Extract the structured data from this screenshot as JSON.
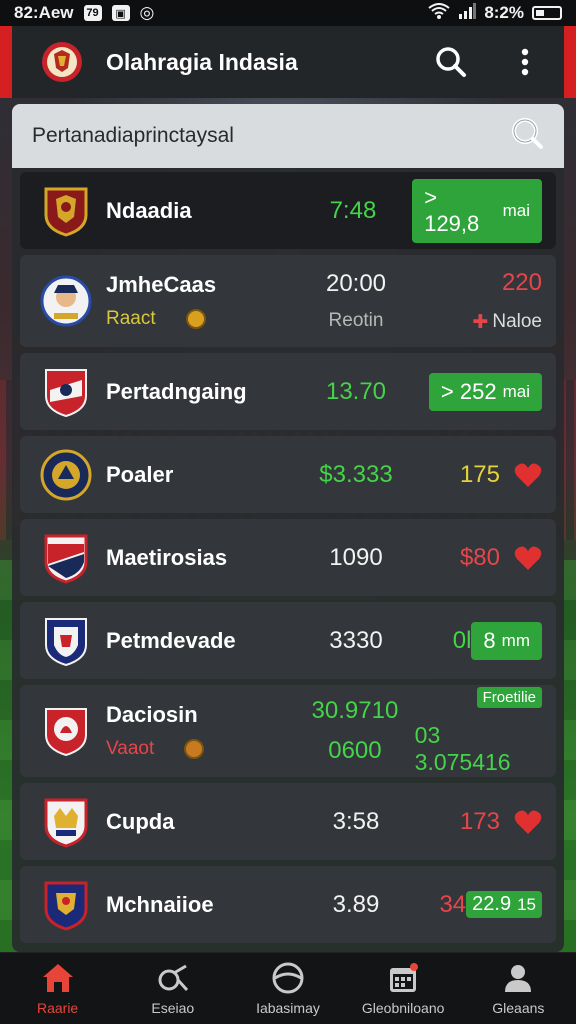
{
  "status_bar": {
    "time": "82:Aew",
    "icon_a": "79",
    "battery_text": "8:2%"
  },
  "app_bar": {
    "title": "Olahragia Indasia",
    "icons": [
      "crest-icon",
      "search-icon",
      "more-vert-icon"
    ]
  },
  "search": {
    "placeholder": "Pertanadiaprinctaysal"
  },
  "rows": [
    {
      "name": "Ndaadia",
      "score": "7:48",
      "score_color": "green",
      "pill": "> 129,8",
      "pill_unit": "mai"
    },
    {
      "name": "JmheCaas",
      "sub_left": "Raact",
      "score": "20:00",
      "score_sub": "Reotin",
      "right": "220",
      "right_sub": "Naloe"
    },
    {
      "name": "Pertadngaing",
      "score": "13.70",
      "score_color": "green",
      "pill": "> 252",
      "pill_unit": "mai"
    },
    {
      "name": "Poaler",
      "score": "$3.333",
      "score_color": "green",
      "right": "175"
    },
    {
      "name": "Maetirosias",
      "score": "1090",
      "right": "$80"
    },
    {
      "name": "Petmdevade",
      "score": "3330",
      "right": "0l",
      "pill": "8",
      "pill_unit": "mm"
    },
    {
      "name": "Daciosin",
      "sub_left": "Vaaot",
      "score": "30.9710",
      "score_sub": "0600",
      "tag": "Froetilie",
      "right": "03 3.075416"
    },
    {
      "name": "Cupda",
      "score": "3:58",
      "right": "173"
    },
    {
      "name": "Mchnaiioe",
      "score": "3.89",
      "right": "34",
      "pill": "22.9",
      "pill_unit": "15"
    }
  ],
  "bottom_nav": [
    {
      "label": "Raarie",
      "icon": "home-icon"
    },
    {
      "label": "Eseiao",
      "icon": "whistle-icon"
    },
    {
      "label": "Iabasimay",
      "icon": "ball-icon"
    },
    {
      "label": "Gleobniloano",
      "icon": "calendar-icon"
    },
    {
      "label": "Gleaans",
      "icon": "profile-icon"
    }
  ],
  "colors": {
    "accent_red": "#d42020",
    "green": "#2ea43a",
    "text_green": "#45d34a",
    "text_red": "#e8454a",
    "text_yellow": "#e6d23a"
  }
}
